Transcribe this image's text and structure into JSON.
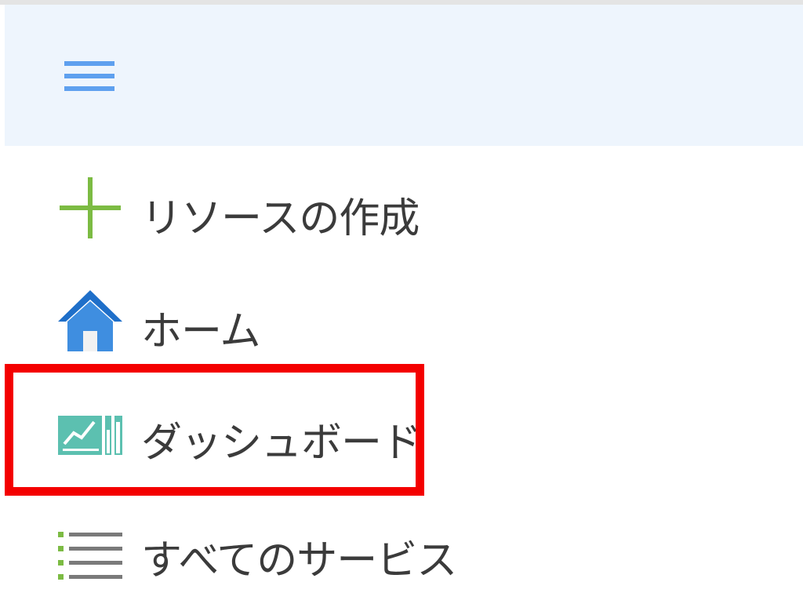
{
  "header": {
    "menu_icon": "hamburger-menu-icon"
  },
  "nav": {
    "items": [
      {
        "id": "create",
        "label": "リソースの作成",
        "icon": "plus-icon",
        "icon_color": "#7cbb43"
      },
      {
        "id": "home",
        "label": "ホーム",
        "icon": "home-icon",
        "icon_color": "#2d7fd6"
      },
      {
        "id": "dashboard",
        "label": "ダッシュボード",
        "icon": "dashboard-icon",
        "icon_color": "#4fb6a6"
      },
      {
        "id": "all-services",
        "label": "すべてのサービス",
        "icon": "list-icon",
        "icon_color": "#7cbb43"
      }
    ]
  },
  "highlight": {
    "target": "dashboard",
    "color": "#f40000"
  },
  "colors": {
    "header_bg": "#eef5fd",
    "hamburger": "#5ea0ef",
    "text": "#3b3b3b"
  }
}
